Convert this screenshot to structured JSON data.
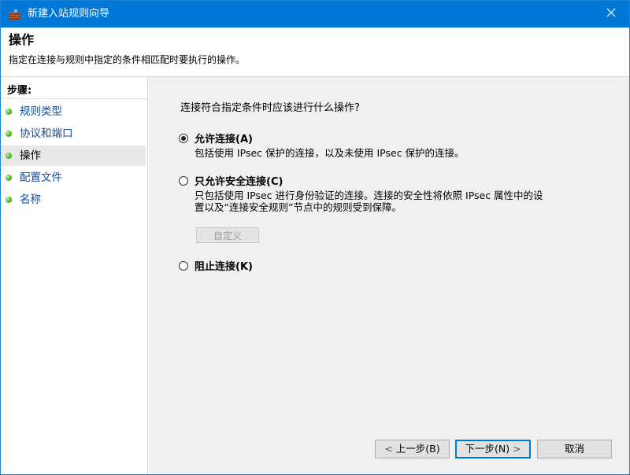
{
  "window": {
    "title": "新建入站规则向导"
  },
  "header": {
    "title": "操作",
    "description": "指定在连接与规则中指定的条件相匹配时要执行的操作。"
  },
  "sidebar": {
    "steps_label": "步骤:",
    "items": [
      {
        "label": "规则类型",
        "active": false
      },
      {
        "label": "协议和端口",
        "active": false
      },
      {
        "label": "操作",
        "active": true
      },
      {
        "label": "配置文件",
        "active": false
      },
      {
        "label": "名称",
        "active": false
      }
    ]
  },
  "main": {
    "question": "连接符合指定条件时应该进行什么操作?",
    "options": [
      {
        "label": "允许连接(A)",
        "checked": true,
        "description": "包括使用 IPsec 保护的连接，以及未使用 IPsec 保护的连接。"
      },
      {
        "label": "只允许安全连接(C)",
        "checked": false,
        "description_line1": "只包括使用 IPsec 进行身份验证的连接。连接的安全性将依照 IPsec 属性中的设",
        "description_line2": "置以及“连接安全规则”节点中的规则受到保障。"
      },
      {
        "label": "阻止连接(K)",
        "checked": false
      }
    ],
    "customize_label": "自定义"
  },
  "footer": {
    "back_label": "上一步(B)",
    "next_label": "下一步(N)",
    "cancel_label": "取消"
  },
  "colors": {
    "titlebar": "#0078d7",
    "content_bg": "#f0f0f0",
    "step_link": "#0e4fa0"
  }
}
